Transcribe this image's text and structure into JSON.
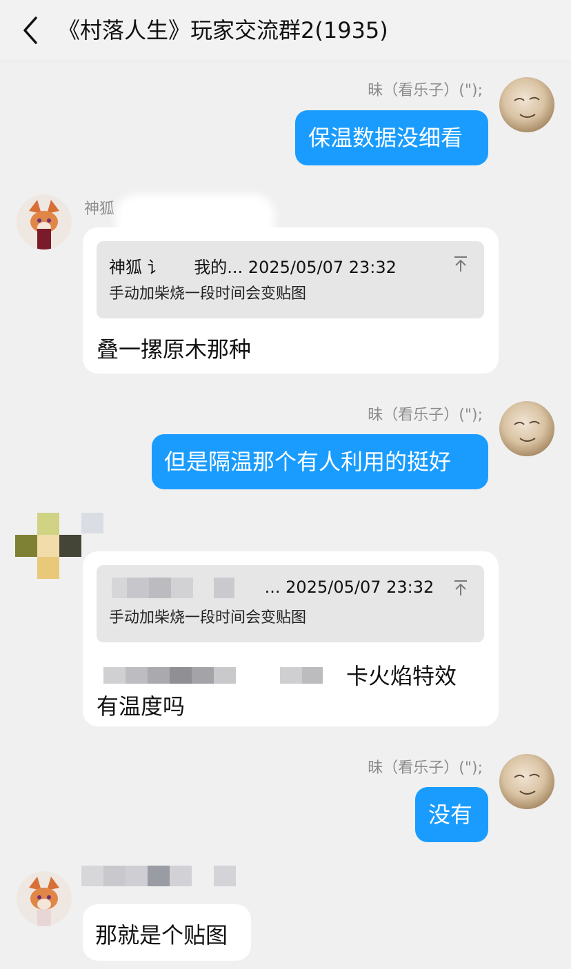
{
  "header": {
    "title": "《村落人生》玩家交流群2(1935)"
  },
  "messages": [
    {
      "sender": "昧（看乐子）(\");",
      "text": "保温数据没细看",
      "direction": "out"
    },
    {
      "sender": "神狐",
      "direction": "in",
      "quote": {
        "author": "神狐 讠",
        "snippet": "我的... 2025/05/07 23:32",
        "text": "手动加柴烧一段时间会变贴图"
      },
      "text": "叠一摞原木那种"
    },
    {
      "sender": "昧（看乐子）(\");",
      "text": "但是隔温那个有人利用的挺好",
      "direction": "out"
    },
    {
      "direction": "in",
      "quote": {
        "snippet": "... 2025/05/07 23:32",
        "text": "手动加柴烧一段时间会变贴图"
      },
      "text_line1": "卡火焰特效",
      "text_line2": "有温度吗"
    },
    {
      "sender": "昧（看乐子）(\");",
      "text": "没有",
      "direction": "out"
    },
    {
      "direction": "in",
      "text": "那就是个贴图"
    }
  ],
  "icons": {
    "back": "chevron-left-icon",
    "pin_top": "arrow-to-top-icon"
  },
  "colors": {
    "outgoing_bubble": "#1a9cff",
    "incoming_bubble": "#ffffff",
    "background": "#f0f0f0",
    "quote_bg": "#e6e6e6"
  }
}
